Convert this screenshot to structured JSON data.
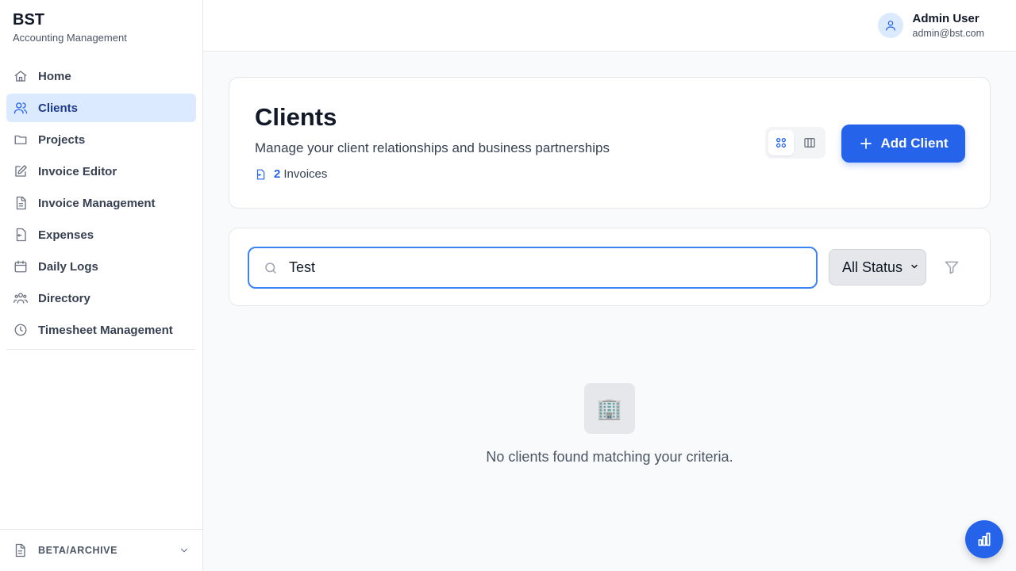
{
  "brand": {
    "name": "BST",
    "subtitle": "Accounting Management"
  },
  "sidebar": {
    "items": [
      {
        "label": "Home",
        "icon": "home-icon"
      },
      {
        "label": "Clients",
        "icon": "users-icon",
        "active": true
      },
      {
        "label": "Projects",
        "icon": "folder-icon"
      },
      {
        "label": "Invoice Editor",
        "icon": "edit-icon"
      },
      {
        "label": "Invoice Management",
        "icon": "file-icon"
      },
      {
        "label": "Expenses",
        "icon": "receipt-icon"
      },
      {
        "label": "Daily Logs",
        "icon": "calendar-icon"
      },
      {
        "label": "Directory",
        "icon": "group-icon"
      },
      {
        "label": "Timesheet Management",
        "icon": "clock-icon"
      }
    ],
    "footer_label": "BETA/ARCHIVE"
  },
  "user": {
    "name": "Admin User",
    "email": "admin@bst.com"
  },
  "page": {
    "title": "Clients",
    "subtitle": "Manage your client relationships and business partnerships",
    "invoice_count": "2",
    "invoice_label": "Invoices",
    "add_button": "Add Client"
  },
  "filters": {
    "search_value": "Test",
    "status_selected": "All Status"
  },
  "empty_state": {
    "icon": "🏢",
    "message": "No clients found matching your criteria."
  },
  "colors": {
    "accent": "#2563eb",
    "active_bg": "#dbeafe",
    "active_text": "#1e3a8a"
  }
}
